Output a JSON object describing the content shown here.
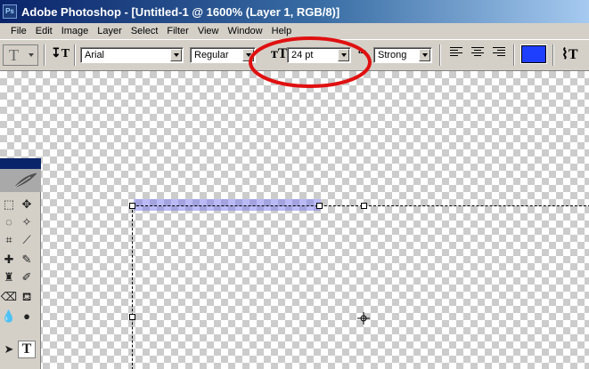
{
  "window": {
    "title": "Adobe Photoshop - [Untitled-1 @ 1600% (Layer 1, RGB/8)]",
    "app_icon": "Ps"
  },
  "menu": {
    "items": [
      "File",
      "Edit",
      "Image",
      "Layer",
      "Select",
      "Filter",
      "View",
      "Window",
      "Help"
    ]
  },
  "options_bar": {
    "tool_preset_icon": "type-tool-icon",
    "orientation_icon": "toggle-text-orientation-icon",
    "font_family": "Arial",
    "font_style": "Regular",
    "font_size": "24 pt",
    "antialias": "Strong",
    "alignment": [
      "left",
      "center",
      "right"
    ],
    "text_color": "#1f3fff",
    "warp_icon": "warp-text-icon"
  },
  "annotation": {
    "color": "#e01010"
  },
  "toolbox": {
    "header_color": "#0a246a",
    "tools": [
      "rectangular-marquee",
      "move",
      "lasso",
      "magic-wand",
      "crop",
      "slice",
      "healing-brush",
      "brush",
      "clone-stamp",
      "history-brush",
      "eraser",
      "paint-bucket",
      "blur",
      "dodge",
      "path-selection",
      "type"
    ]
  }
}
